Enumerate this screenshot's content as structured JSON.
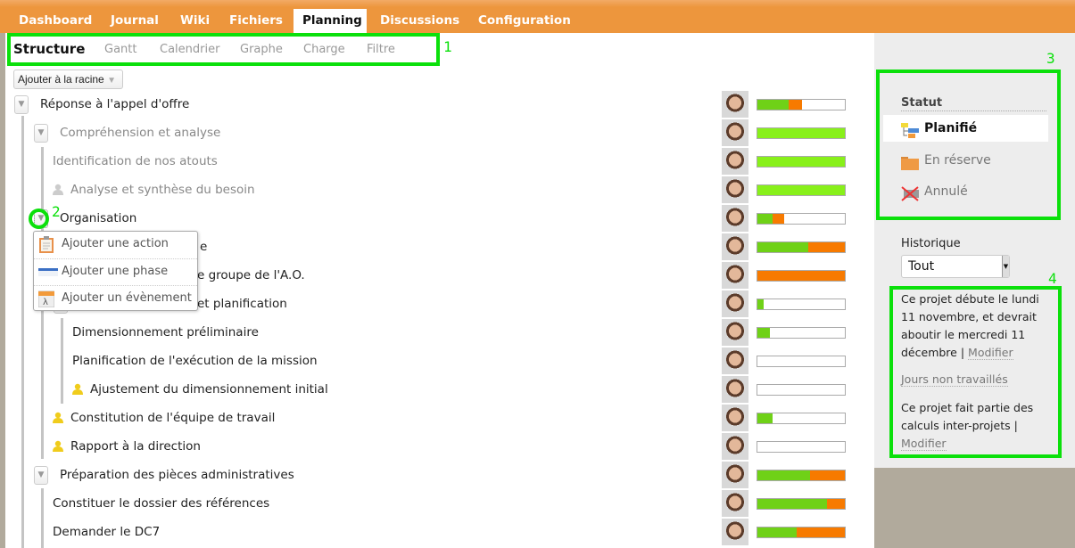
{
  "nav": {
    "tabs": [
      "Dashboard",
      "Journal",
      "Wiki",
      "Fichiers",
      "Planning",
      "Discussions",
      "Configuration"
    ],
    "active": "Planning"
  },
  "subnav": {
    "tabs": [
      "Structure",
      "Gantt",
      "Calendrier",
      "Graphe",
      "Charge",
      "Filtre"
    ],
    "active": "Structure"
  },
  "add_root": {
    "label": "Ajouter à la racine",
    "icon": "triangle-down"
  },
  "tree": {
    "rows": [
      {
        "label": "Réponse à l'appel d'offre",
        "progress": {
          "done": 36,
          "late": 15
        }
      },
      {
        "label": "Compréhension et analyse",
        "progress": {
          "done": 100,
          "late": 0,
          "complete": true
        }
      },
      {
        "label": "Identification de nos atouts",
        "progress": {
          "done": 100,
          "late": 0,
          "complete": true
        }
      },
      {
        "label": "Analyse et synthèse du besoin",
        "progress": {
          "done": 100,
          "late": 0,
          "complete": true
        }
      },
      {
        "label": "Organisation",
        "progress": {
          "done": 17,
          "late": 14
        }
      },
      {
        "label": "e",
        "progress": {
          "done": 58,
          "late": 42
        }
      },
      {
        "label": "e groupe de l'A.O.",
        "progress": {
          "done": 0,
          "late": 100
        }
      },
      {
        "label": "et planification",
        "progress": {
          "done": 7,
          "late": 0
        }
      },
      {
        "label": "Dimensionnement préliminaire",
        "progress": {
          "done": 14,
          "late": 0
        }
      },
      {
        "label": "Planification de l'exécution de la mission",
        "progress": {
          "done": 0,
          "late": 0
        }
      },
      {
        "label": "Ajustement du dimensionnement initial",
        "progress": {
          "done": 0,
          "late": 0
        }
      },
      {
        "label": "Constitution de l'équipe de travail",
        "progress": {
          "done": 17,
          "late": 0
        }
      },
      {
        "label": "Rapport à la direction",
        "progress": {
          "done": 0,
          "late": 0
        }
      },
      {
        "label": "Préparation des pièces administratives",
        "progress": {
          "done": 60,
          "late": 40
        }
      },
      {
        "label": "Constituer le dossier des références",
        "progress": {
          "done": 80,
          "late": 20
        }
      },
      {
        "label": "Demander le DC7",
        "progress": {
          "done": 45,
          "late": 55
        }
      }
    ]
  },
  "context_menu": {
    "items": [
      "Ajouter une action",
      "Ajouter une phase",
      "Ajouter un évènement"
    ]
  },
  "sidebar": {
    "status_title": "Statut",
    "statuses": [
      "Planifié",
      "En réserve",
      "Annulé"
    ],
    "selected_status": "Planifié",
    "history_label": "Historique",
    "history_value": "Tout",
    "info1": "Ce projet débute le lundi 11 novembre, et devrait aboutir le mercredi 11 décembre",
    "sep": "|",
    "modify": "Modifier",
    "non_worked": "Jours non travaillés",
    "info2": "Ce projet fait partie des calculs inter-projets"
  },
  "annotations": [
    "1",
    "2",
    "3",
    "4"
  ],
  "colors": {
    "header": "#ed963d",
    "done": "#6fd117",
    "complete": "#88f01a",
    "late": "#f77a00",
    "annotation": "#0be00b"
  }
}
